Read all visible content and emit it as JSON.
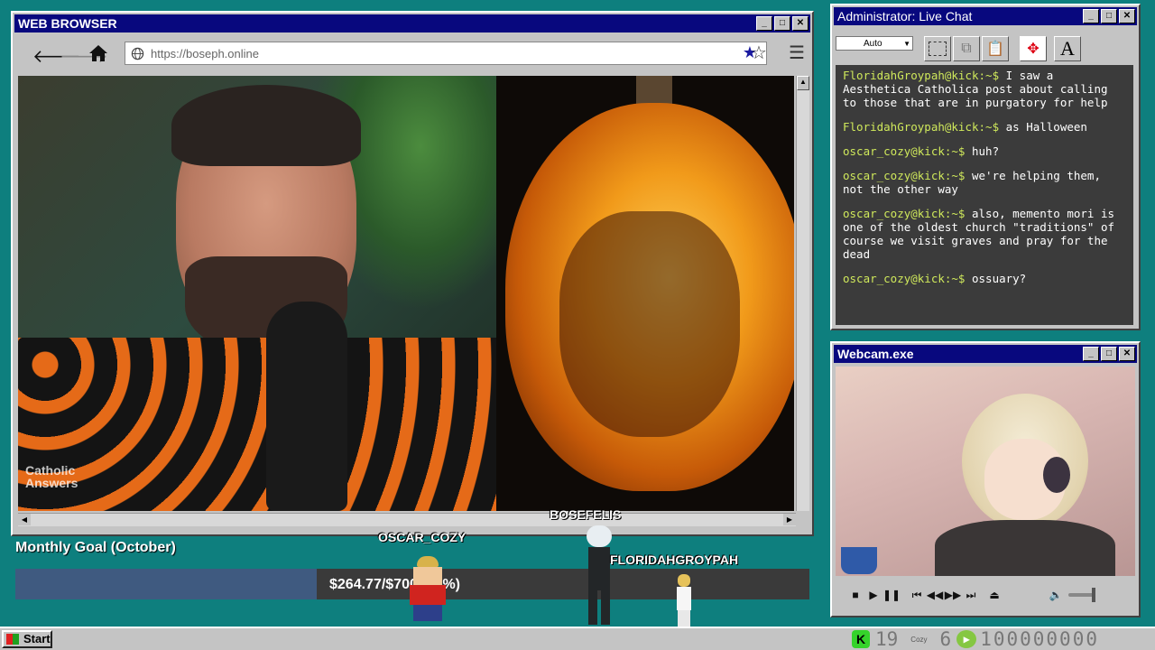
{
  "browser": {
    "title": "WEB BROWSER",
    "url": "https://boseph.online",
    "video_watermark": "Catholic Answers"
  },
  "chat": {
    "title": "Administrator: Live Chat",
    "font_select": "Auto",
    "messages": [
      {
        "user": "FloridahGroypah@kick:~$",
        "text": " I saw a Aesthetica Catholica post about calling to those that are in purgatory for help"
      },
      {
        "user": "FloridahGroypah@kick:~$",
        "text": " as Halloween"
      },
      {
        "user": "oscar_cozy@kick:~$",
        "text": " huh?"
      },
      {
        "user": "oscar_cozy@kick:~$",
        "text": " we're helping them, not the other way"
      },
      {
        "user": "oscar_cozy@kick:~$",
        "text": " also, memento mori is one of the oldest church \"traditions\" of course we visit graves and pray for the dead"
      },
      {
        "user": "oscar_cozy@kick:~$",
        "text": " ossuary?"
      }
    ]
  },
  "webcam": {
    "title": "Webcam.exe"
  },
  "goal": {
    "label": "Monthly Goal (October)",
    "amount_text": "$264.77/$700 (38%)",
    "progress": 0.38
  },
  "avatars": {
    "names": [
      "OSCAR_COZY",
      "BOSEFELIS",
      "FLORIDAHGROYPAH"
    ]
  },
  "taskbar": {
    "start_label": "Start",
    "kick_count": "19",
    "cozy_label": "Cozy",
    "cozy_count": "6",
    "rumble_count": "100000000"
  },
  "colors": {
    "desktop": "#0e7f7e",
    "titlebar": "#08087e",
    "chat_bg": "#3b3b3b",
    "chat_user": "#cfe85b",
    "goal_fill": "#3f5a80",
    "goal_bg": "#3a3a3a",
    "star": "#1a1aa0"
  }
}
